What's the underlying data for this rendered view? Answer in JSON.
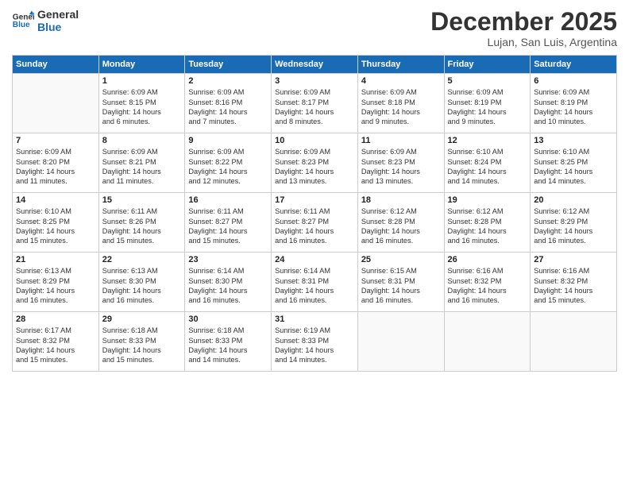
{
  "logo": {
    "line1": "General",
    "line2": "Blue"
  },
  "title": "December 2025",
  "subtitle": "Lujan, San Luis, Argentina",
  "header_days": [
    "Sunday",
    "Monday",
    "Tuesday",
    "Wednesday",
    "Thursday",
    "Friday",
    "Saturday"
  ],
  "weeks": [
    [
      {
        "day": "",
        "info": ""
      },
      {
        "day": "1",
        "info": "Sunrise: 6:09 AM\nSunset: 8:15 PM\nDaylight: 14 hours\nand 6 minutes."
      },
      {
        "day": "2",
        "info": "Sunrise: 6:09 AM\nSunset: 8:16 PM\nDaylight: 14 hours\nand 7 minutes."
      },
      {
        "day": "3",
        "info": "Sunrise: 6:09 AM\nSunset: 8:17 PM\nDaylight: 14 hours\nand 8 minutes."
      },
      {
        "day": "4",
        "info": "Sunrise: 6:09 AM\nSunset: 8:18 PM\nDaylight: 14 hours\nand 9 minutes."
      },
      {
        "day": "5",
        "info": "Sunrise: 6:09 AM\nSunset: 8:19 PM\nDaylight: 14 hours\nand 9 minutes."
      },
      {
        "day": "6",
        "info": "Sunrise: 6:09 AM\nSunset: 8:19 PM\nDaylight: 14 hours\nand 10 minutes."
      }
    ],
    [
      {
        "day": "7",
        "info": "Sunrise: 6:09 AM\nSunset: 8:20 PM\nDaylight: 14 hours\nand 11 minutes."
      },
      {
        "day": "8",
        "info": "Sunrise: 6:09 AM\nSunset: 8:21 PM\nDaylight: 14 hours\nand 11 minutes."
      },
      {
        "day": "9",
        "info": "Sunrise: 6:09 AM\nSunset: 8:22 PM\nDaylight: 14 hours\nand 12 minutes."
      },
      {
        "day": "10",
        "info": "Sunrise: 6:09 AM\nSunset: 8:23 PM\nDaylight: 14 hours\nand 13 minutes."
      },
      {
        "day": "11",
        "info": "Sunrise: 6:09 AM\nSunset: 8:23 PM\nDaylight: 14 hours\nand 13 minutes."
      },
      {
        "day": "12",
        "info": "Sunrise: 6:10 AM\nSunset: 8:24 PM\nDaylight: 14 hours\nand 14 minutes."
      },
      {
        "day": "13",
        "info": "Sunrise: 6:10 AM\nSunset: 8:25 PM\nDaylight: 14 hours\nand 14 minutes."
      }
    ],
    [
      {
        "day": "14",
        "info": "Sunrise: 6:10 AM\nSunset: 8:25 PM\nDaylight: 14 hours\nand 15 minutes."
      },
      {
        "day": "15",
        "info": "Sunrise: 6:11 AM\nSunset: 8:26 PM\nDaylight: 14 hours\nand 15 minutes."
      },
      {
        "day": "16",
        "info": "Sunrise: 6:11 AM\nSunset: 8:27 PM\nDaylight: 14 hours\nand 15 minutes."
      },
      {
        "day": "17",
        "info": "Sunrise: 6:11 AM\nSunset: 8:27 PM\nDaylight: 14 hours\nand 16 minutes."
      },
      {
        "day": "18",
        "info": "Sunrise: 6:12 AM\nSunset: 8:28 PM\nDaylight: 14 hours\nand 16 minutes."
      },
      {
        "day": "19",
        "info": "Sunrise: 6:12 AM\nSunset: 8:28 PM\nDaylight: 14 hours\nand 16 minutes."
      },
      {
        "day": "20",
        "info": "Sunrise: 6:12 AM\nSunset: 8:29 PM\nDaylight: 14 hours\nand 16 minutes."
      }
    ],
    [
      {
        "day": "21",
        "info": "Sunrise: 6:13 AM\nSunset: 8:29 PM\nDaylight: 14 hours\nand 16 minutes."
      },
      {
        "day": "22",
        "info": "Sunrise: 6:13 AM\nSunset: 8:30 PM\nDaylight: 14 hours\nand 16 minutes."
      },
      {
        "day": "23",
        "info": "Sunrise: 6:14 AM\nSunset: 8:30 PM\nDaylight: 14 hours\nand 16 minutes."
      },
      {
        "day": "24",
        "info": "Sunrise: 6:14 AM\nSunset: 8:31 PM\nDaylight: 14 hours\nand 16 minutes."
      },
      {
        "day": "25",
        "info": "Sunrise: 6:15 AM\nSunset: 8:31 PM\nDaylight: 14 hours\nand 16 minutes."
      },
      {
        "day": "26",
        "info": "Sunrise: 6:16 AM\nSunset: 8:32 PM\nDaylight: 14 hours\nand 16 minutes."
      },
      {
        "day": "27",
        "info": "Sunrise: 6:16 AM\nSunset: 8:32 PM\nDaylight: 14 hours\nand 15 minutes."
      }
    ],
    [
      {
        "day": "28",
        "info": "Sunrise: 6:17 AM\nSunset: 8:32 PM\nDaylight: 14 hours\nand 15 minutes."
      },
      {
        "day": "29",
        "info": "Sunrise: 6:18 AM\nSunset: 8:33 PM\nDaylight: 14 hours\nand 15 minutes."
      },
      {
        "day": "30",
        "info": "Sunrise: 6:18 AM\nSunset: 8:33 PM\nDaylight: 14 hours\nand 14 minutes."
      },
      {
        "day": "31",
        "info": "Sunrise: 6:19 AM\nSunset: 8:33 PM\nDaylight: 14 hours\nand 14 minutes."
      },
      {
        "day": "",
        "info": ""
      },
      {
        "day": "",
        "info": ""
      },
      {
        "day": "",
        "info": ""
      }
    ]
  ]
}
